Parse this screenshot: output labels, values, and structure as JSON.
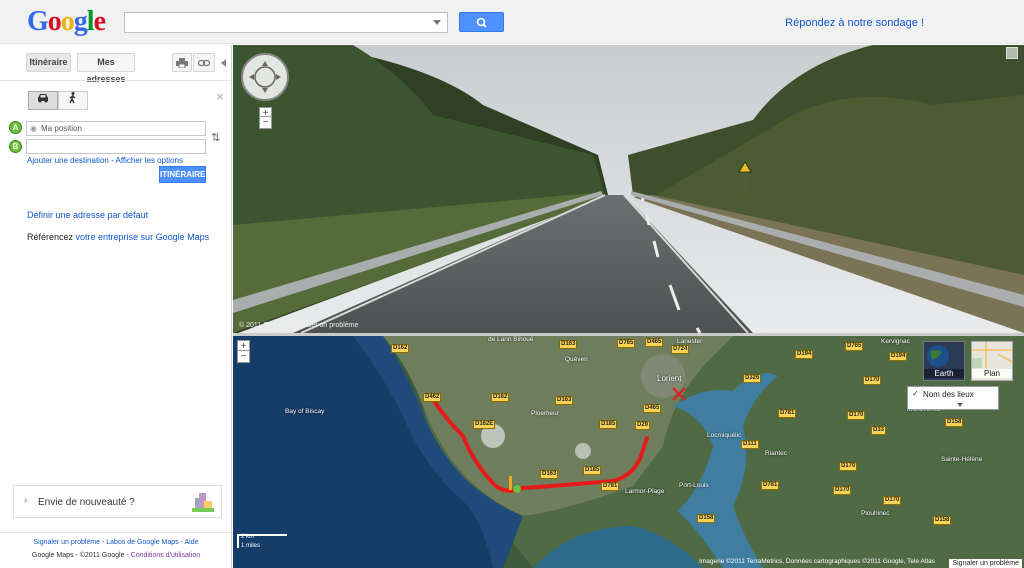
{
  "header": {
    "logo_letters": [
      "G",
      "o",
      "o",
      "g",
      "l",
      "e"
    ],
    "survey_link": "Répondez à notre sondage !"
  },
  "sidebar": {
    "tab_itinerary": "Itinéraire",
    "tab_addresses": "Mes adresses",
    "print_icon": "print-icon",
    "link_icon": "link-icon",
    "marker_a": "A",
    "marker_b": "B",
    "field_a_value": "Ma position",
    "field_b_value": "",
    "add_destination": "Ajouter une destination",
    "separator": " - ",
    "show_options": "Afficher les options",
    "go_button": "ITINÉRAIRE",
    "default_address": "Définir une adresse par défaut",
    "business_prefix": "Référencez ",
    "business_link": "votre entreprise sur Google Maps",
    "news_label": "Envie de nouveauté ?",
    "footer_report": "Signaler un problème",
    "footer_labs": "Labos de Google Maps",
    "footer_help": "Aide",
    "footer_copyright": "Google Maps - ©2011 Google - ",
    "footer_terms": "Conditions d'utilisation",
    "footer_dash": " - "
  },
  "streetview": {
    "copyright": "© 2011 Google · Signaler un problème"
  },
  "map": {
    "layer_earth": "Earth",
    "layer_plan": "Plan",
    "places_label": "Nom des lieux",
    "scale_km": "2 km",
    "scale_mi": "1 miles",
    "copyright": "Imagerie ©2011 TerraMetrics, Données cartographiques ©2011 Google, Tele Atlas",
    "report": "Signaler un problème",
    "place_names": [
      {
        "name": "Lorient",
        "dark": false
      },
      {
        "name": "Lanester",
        "dark": false
      },
      {
        "name": "Bay of Biscay",
        "dark": false
      },
      {
        "name": "Ploemeur",
        "dark": false
      },
      {
        "name": "Larmor-Plage",
        "dark": false
      },
      {
        "name": "Port-Louis",
        "dark": false
      },
      {
        "name": "Locmiquélic",
        "dark": false
      },
      {
        "name": "Riantec",
        "dark": false
      },
      {
        "name": "Merlevenez",
        "dark": false
      },
      {
        "name": "Plouhinec",
        "dark": false
      },
      {
        "name": "Kervignac",
        "dark": false
      },
      {
        "name": "Sainte-Hélène",
        "dark": false
      },
      {
        "name": "de Lann Bihoué",
        "dark": false
      },
      {
        "name": "Quéven",
        "dark": false
      }
    ],
    "roads": [
      "D162",
      "D163",
      "D765",
      "D465",
      "D724",
      "D194",
      "D765",
      "D326",
      "D462",
      "D162",
      "D163",
      "D29",
      "D465",
      "D162E",
      "D185",
      "D111",
      "D781",
      "D170",
      "D33",
      "D158",
      "D163",
      "D185",
      "D781",
      "D781",
      "D170",
      "D158",
      "D158",
      "D194",
      "D170",
      "D170",
      "D170"
    ]
  }
}
